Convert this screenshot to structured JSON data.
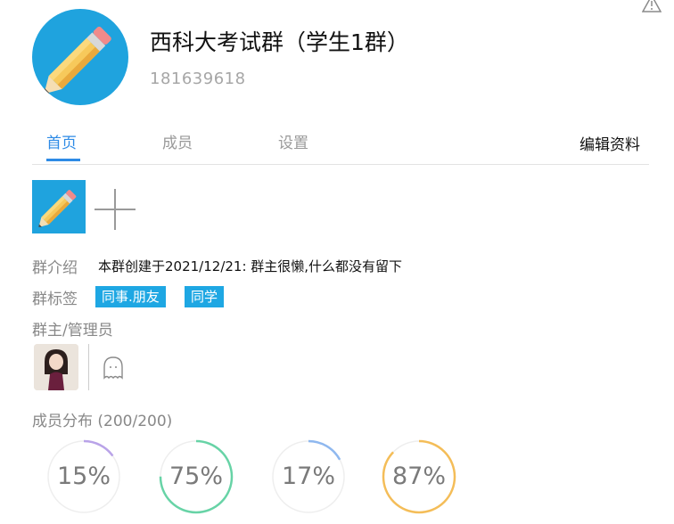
{
  "header": {
    "group_name": "西科大考试群（学生1群）",
    "group_id": "181639618"
  },
  "tabs": [
    {
      "label": "首页",
      "active": true
    },
    {
      "label": "成员",
      "active": false
    },
    {
      "label": "设置",
      "active": false
    }
  ],
  "edit_profile_label": "编辑资料",
  "info": {
    "intro_label": "群介绍",
    "intro_text": "本群创建于2021/12/21: 群主很懒,什么都没有留下",
    "tags_label": "群标签",
    "tags": [
      "同事.朋友",
      "同学"
    ],
    "admins_label": "群主/管理员",
    "distribution_label": "成员分布 (200/200)"
  },
  "stats": [
    {
      "label": "15%",
      "value": 0.15,
      "color": "#b9a3e8"
    },
    {
      "label": "75%",
      "value": 0.75,
      "color": "#67d3a6"
    },
    {
      "label": "17%",
      "value": 0.17,
      "color": "#8fb8ef"
    },
    {
      "label": "87%",
      "value": 0.87,
      "color": "#f4bd58"
    }
  ],
  "icons": {
    "avatar": "pencil-icon",
    "add": "plus-icon",
    "ghost": "ghost-icon",
    "warning": "warning-icon"
  },
  "colors": {
    "accent": "#2e8be6",
    "tag": "#1ea7e3",
    "avatar_bg": "#1fa3de"
  }
}
